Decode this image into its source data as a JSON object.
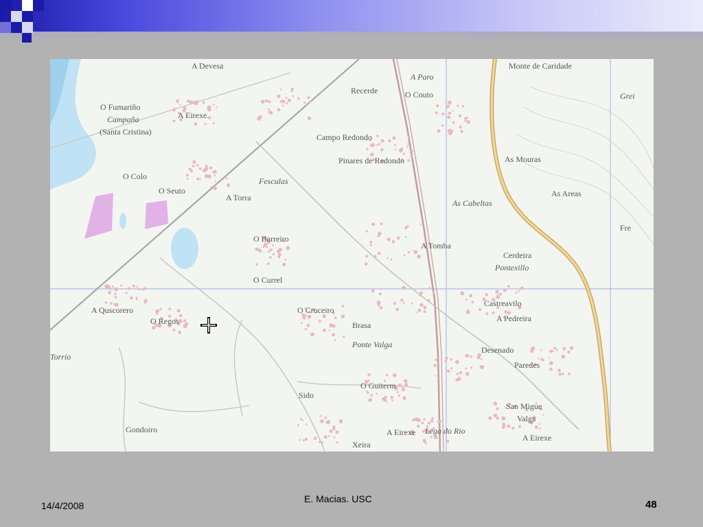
{
  "slide": {
    "footer_date": "14/4/2008",
    "footer_author": "E. Macias. USC",
    "page_number": "48"
  },
  "map": {
    "labels": [
      "A Devesa",
      "A Paro",
      "Recerde",
      "O Couto",
      "Monte de Caridade",
      "O Fumariño",
      "Campaña",
      "(Santa Cristina)",
      "A Eirexe",
      "Campo Redondo",
      "Pinares de Redondo",
      "Fesculas",
      "O Colo",
      "O Seuto",
      "A Torra",
      "As Mouras",
      "As Cabeltas",
      "O Barreiro",
      "O Currel",
      "A Tomba",
      "Cerdeira",
      "Pontexillo",
      "A Quscorero",
      "O Regos",
      "O Cruceiro",
      "Brasa",
      "Ponte Valga",
      "Castreavilo",
      "A Pedreira",
      "Desenado",
      "Paredes",
      "Torrio",
      "O Guiterm",
      "Sido",
      "Gondoiro",
      "A Eirexe",
      "Lega do Rio",
      "San Migue",
      "Valga",
      "A Eirexe",
      "Xeira",
      "Grei",
      "As Areas",
      "Fre"
    ],
    "colors": {
      "background": "#f3f6f0",
      "water": "#bfe3f4",
      "built_area": "#e9b7c8",
      "pink_feature": "#e1b2e6",
      "road_main": "#e8c27a",
      "rail": "#c49aa2",
      "grid": "#aeb8de"
    }
  }
}
